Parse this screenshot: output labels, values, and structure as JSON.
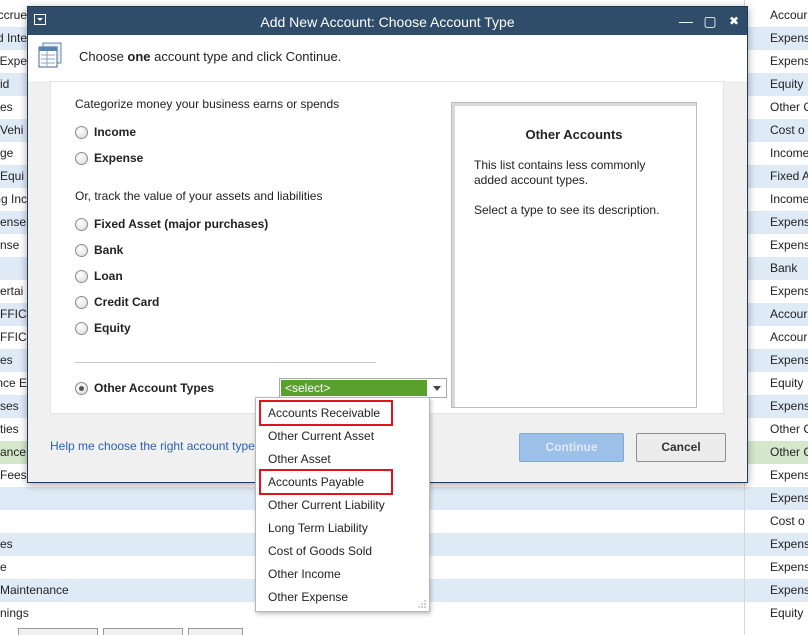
{
  "background": {
    "left_rows": [
      "Accrue",
      "d Inte",
      "Expe",
      "id",
      "es",
      "Vehi",
      "ge",
      "Equi",
      "ng Inc",
      "ense",
      "nse",
      "",
      "ertai",
      "FFIC",
      "FFIC",
      "es",
      "nce E",
      "ses",
      "ties",
      "ance",
      "Fees",
      "",
      "",
      "es",
      "e",
      "Maintenance",
      "nings"
    ],
    "right_rows": [
      "Accour",
      "Expens",
      "Expens",
      "Equity",
      "Other C",
      "Cost o",
      "Income",
      "Fixed A",
      "Income",
      "Expens",
      "Expens",
      "Bank",
      "Expens",
      "Accour",
      "Accour",
      "Expens",
      "Equity",
      "Expens",
      "Other C",
      "Other C",
      "Expens",
      "Expens",
      "Cost o",
      "Expens",
      "Expens",
      "Expens",
      "Equity"
    ],
    "row_colors": [
      "#ffffff",
      "#dfeaf7",
      "#ffffff",
      "#dfeaf7",
      "#ffffff",
      "#dfeaf7",
      "#ffffff",
      "#dfeaf7",
      "#ffffff",
      "#dfeaf7",
      "#ffffff",
      "#dfeaf7",
      "#ffffff",
      "#dfeaf7",
      "#ffffff",
      "#dfeaf7",
      "#ffffff",
      "#dfeaf7",
      "#ffffff",
      "#d5e8cc",
      "#ffffff",
      "#dfeaf7",
      "#ffffff",
      "#dfeaf7",
      "#ffffff",
      "#dfeaf7",
      "#ffffff"
    ]
  },
  "dialog": {
    "title": "Add New Account: Choose Account Type",
    "minimize": "—",
    "maximize": "▢",
    "close": "✖",
    "instruction_pre": "Choose ",
    "instruction_bold": "one",
    "instruction_post": " account type and click Continue.",
    "section1_label": "Categorize money your business earns or spends",
    "section2_label": "Or, track the value of your assets and liabilities",
    "radio": {
      "income": "Income",
      "expense": "Expense",
      "fixed_asset": "Fixed Asset (major purchases)",
      "bank": "Bank",
      "loan": "Loan",
      "credit_card": "Credit Card",
      "equity": "Equity",
      "other": "Other Account Types"
    },
    "select_value": "<select>",
    "description": {
      "title": "Other Accounts",
      "text": "This list contains less commonly added account types.",
      "hint": "Select a type to see its description."
    },
    "help_link": "Help me choose the right account type",
    "continue_label": "Continue",
    "cancel_label": "Cancel"
  },
  "dropdown": {
    "items": [
      "Accounts Receivable",
      "Other Current Asset",
      "Other Asset",
      "Accounts Payable",
      "Other Current Liability",
      "Long Term Liability",
      "Cost of Goods Sold",
      "Other Income",
      "Other Expense"
    ],
    "highlighted": [
      "Accounts Receivable",
      "Accounts Payable"
    ],
    "highlight_color": "#e0141e"
  },
  "colors": {
    "titlebar": "#2f4d6b",
    "select_green": "#5aa02c",
    "link": "#2a62b4",
    "continue_disabled": "#9cc0e8"
  }
}
